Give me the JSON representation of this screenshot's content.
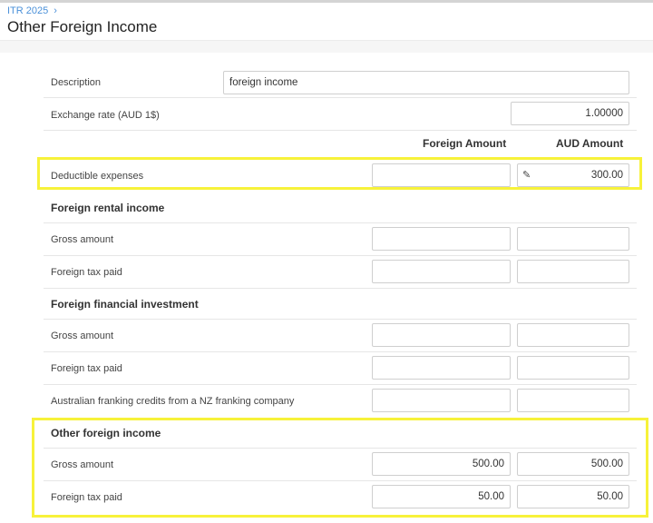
{
  "breadcrumb": {
    "root": "ITR 2025",
    "separator": "›"
  },
  "page_title": "Other Foreign Income",
  "form": {
    "description": {
      "label": "Description",
      "value": "foreign income"
    },
    "exchange_rate": {
      "label": "Exchange rate (AUD 1$)",
      "value": "1.00000"
    },
    "columns": {
      "foreign": "Foreign Amount",
      "aud": "AUD Amount"
    },
    "deductible": {
      "label": "Deductible expenses",
      "foreign": "",
      "aud": "300.00"
    },
    "rental": {
      "title": "Foreign rental income",
      "gross": {
        "label": "Gross amount",
        "foreign": "",
        "aud": ""
      },
      "tax": {
        "label": "Foreign tax paid",
        "foreign": "",
        "aud": ""
      }
    },
    "investment": {
      "title": "Foreign financial investment",
      "gross": {
        "label": "Gross amount",
        "foreign": "",
        "aud": ""
      },
      "tax": {
        "label": "Foreign tax paid",
        "foreign": "",
        "aud": ""
      },
      "franking": {
        "label": "Australian franking credits from a NZ franking company",
        "foreign": "",
        "aud": ""
      }
    },
    "other": {
      "title": "Other foreign income",
      "gross": {
        "label": "Gross amount",
        "foreign": "500.00",
        "aud": "500.00"
      },
      "tax": {
        "label": "Foreign tax paid",
        "foreign": "50.00",
        "aud": "50.00"
      }
    }
  },
  "colors": {
    "highlight": "#f7f23a",
    "link": "#4a90d9"
  },
  "icons": {
    "edit": "pencil-icon"
  }
}
